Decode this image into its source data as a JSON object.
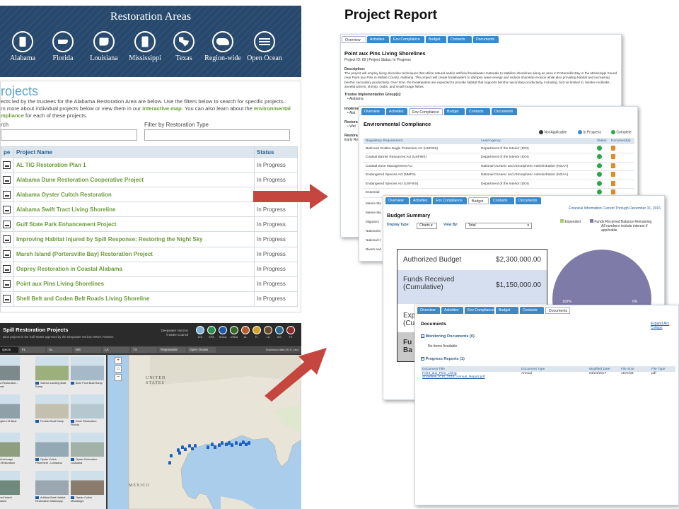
{
  "report_title": "Project Report",
  "areas": {
    "title": "Restoration Areas",
    "items": [
      {
        "label": "Alabama",
        "icon": "alabama-icon"
      },
      {
        "label": "Florida",
        "icon": "florida-icon"
      },
      {
        "label": "Louisiana",
        "icon": "louisiana-icon"
      },
      {
        "label": "Mississippi",
        "icon": "mississippi-icon"
      },
      {
        "label": "Texas",
        "icon": "texas-icon"
      },
      {
        "label": "Region-wide",
        "icon": "region-wide-icon"
      },
      {
        "label": "Open Ocean",
        "icon": "open-ocean-icon"
      }
    ]
  },
  "projects": {
    "heading": "rojects",
    "intro_1": "ects led by the trustees for the Alabama Restoration Area are below. Use the filters below to search for specific projects.",
    "intro_2": "rn more about individual projects below or view them in our ",
    "intro_link_map": "interactive map",
    "intro_3": ". You can also learn about the ",
    "intro_link_env": "environmental",
    "intro_link_env_2": "mpliance",
    "intro_4": " for each of these projects.",
    "search_label": "rch",
    "filter_label": "Filter by Restoration Type",
    "columns": [
      "pe",
      "Project Name",
      "Status"
    ],
    "rows": [
      {
        "name": "AL TIG Restoration Plan 1",
        "status": "In Progress"
      },
      {
        "name": "Alabama Dune Restoration Cooperative Project",
        "status": "In Progress"
      },
      {
        "name": "Alabama Oyster Cultch Restoration",
        "status": ""
      },
      {
        "name": "Alabama Swift Tract Living Shoreline",
        "status": "In Progress"
      },
      {
        "name": "Gulf State Park Enhancement Project",
        "status": "In Progress"
      },
      {
        "name": "Improving Habitat Injured by Spill Response: Restoring the Night Sky",
        "status": "In Progress"
      },
      {
        "name": "Marsh Island (Portersville Bay) Restoration Project",
        "status": "In Progress"
      },
      {
        "name": "Osprey Restoration in Coastal Alabama",
        "status": "In Progress"
      },
      {
        "name": "Point aux Pins Living Shorelines",
        "status": "In Progress"
      },
      {
        "name": "Shell Belt and Coden Belt Roads Living Shoreline",
        "status": "In Progress"
      }
    ]
  },
  "map_panel": {
    "title": "Spill Restoration Projects",
    "subtitle": "ation projects in the Gulf States approved by the Deepwater Horizon NRDA Trustees",
    "trustee": "Deepwater Horizon Trustee Council",
    "logos": [
      "DOI",
      "EPA",
      "NOAA",
      "USDA",
      "AL",
      "FL",
      "LA",
      "MS",
      "TX"
    ],
    "tabs": [
      "ojects",
      "FL",
      "AL",
      "MS",
      "LA",
      "TX",
      "Regionwide",
      "Open Ocean"
    ],
    "download": "Download data (XLS, csv)",
    "map_labels": {
      "us": "UNITED\nSTATES",
      "mexico": "MEXICO"
    },
    "thumbs": [
      "ma Restoration - Lightpost",
      "Salmon Landing Boat Ramp",
      "Bear Point Boat Ramp",
      "lington Hill Boat Ramp",
      "Perdido Boat Ramp",
      "Dune Restoration Florida",
      "n Anchorage Marsh Restoration",
      "Oyster Cultch Placement - Louisiana",
      "Oyster Relocation - Louisiana",
      "Shell Island Restoration",
      "Artificial Reef Habitat Restoration Mississippi",
      "Oyster Cultch Mississippi"
    ]
  },
  "win1": {
    "tabs": [
      "Overview",
      "Activities",
      "Env Compliance",
      "Budget",
      "Contacts",
      "Documents"
    ],
    "title": "Point aux Pins Living Shorelines",
    "meta": "Project ID: 69 | Project Status: In Progress",
    "desc_label": "Description:",
    "desc": "The project will employ living shoreline techniques that utilize natural and/or artificial breakwater materials to stabilize shorelines along an area in Portersville Bay in the Mississippi Sound near Point aux Pins in Mobile County, Alabama. The project will create breakwaters to dampen wave energy and reduce shoreline erosion while also providing habitat and increasing benthic secondary productivity. Over time, the breakwaters are expected to provide habitat that supports benthic secondary productivity, including, but not limited to, bivalve mollusks, annelid worms, shrimp, crabs, and small forage fishes.",
    "trustee_label": "Trustee Implementation Group(s):",
    "trustee_item": "• Alabama",
    "impl_label": "Impleme",
    "impl_item": "• Alal",
    "resto_label": "Restora",
    "resto_item": "• Wet",
    "resto2_label": "Restora",
    "resto2_item": "Early Re"
  },
  "win2": {
    "tabs": [
      "Overview",
      "Activities",
      "Env Compliance",
      "Budget",
      "Contacts",
      "Documents"
    ],
    "title": "Environmental Compliance",
    "legend": [
      "Not Applicable",
      "In Progress",
      "Complete"
    ],
    "columns": [
      "Regulatory Requirement",
      "Lead Agency",
      "Status",
      "Document(s)"
    ],
    "rows": [
      {
        "req": "Bald and Golden Eagle Protection Act (USFWS)",
        "agency": "Department of the Interior (DOI)"
      },
      {
        "req": "Coastal Barrier Resources Act (USFWS)",
        "agency": "Department of the Interior (DOI)"
      },
      {
        "req": "Coastal Zone Management Act",
        "agency": "National Oceanic and Atmospheric Administration (NOAA)"
      },
      {
        "req": "Endangered Species Act (NMFS)",
        "agency": "National Oceanic and Atmospheric Administration (NOAA)"
      },
      {
        "req": "Endangered Species Act (USFWS)",
        "agency": "Department of the Interior (DOI)"
      },
      {
        "req": "Essential",
        "agency": ""
      }
    ],
    "side_items": [
      "Marine Ma",
      "Marine Ma",
      "Migratory",
      "National E",
      "National H",
      "Rivers and"
    ]
  },
  "win3": {
    "tabs": [
      "Overview",
      "Activities",
      "Env Compliance",
      "Budget",
      "Contacts",
      "Documents"
    ],
    "info": "Financial Information Current Through December 31, 2016",
    "title": "Budget Summary",
    "display_label": "Display Type:",
    "display_value": "Charts",
    "view_label": "View By:",
    "view_value": "Total",
    "legend_expended": "Expended",
    "legend_remaining": "Funds Received Balance Remaining",
    "legend_note": "All numbers include interest if applicable",
    "rows": [
      {
        "label": "Authorized Budget",
        "value": "$2,300,000.00"
      },
      {
        "label": "Funds Received (Cumulative)",
        "value": "$1,150,000.00"
      },
      {
        "label": "Exp (Cu",
        "value": ""
      },
      {
        "label": "Fu Ba",
        "value": ""
      }
    ],
    "pie_label_left": "100%",
    "pie_label_right": "0%"
  },
  "win4": {
    "tabs": [
      "Overview",
      "Activities",
      "Env Compliance",
      "Budget",
      "Contacts",
      "Documents"
    ],
    "title": "Documents",
    "expand_link": "Expand All",
    "collapse_link": "Collaps",
    "monitoring": "Monitoring Documents (0)",
    "no_items": "No Items Available",
    "progress": "Progress Reports (1)",
    "columns": [
      "Document Title",
      "Document Type",
      "Modified Date",
      "File Size",
      "File Type"
    ],
    "doc": {
      "title": "Point_aux_Pins_Living Shoreline_ICIS_2016_Annual_Report.pdf",
      "type": "Annual",
      "date": "04/24/2017",
      "size": "1570 kB",
      "ftype": "pdf"
    }
  },
  "colors": {
    "banner": "#27496d",
    "accent_green": "#6a9a3a",
    "tab_blue": "#3a89c9",
    "arrow_red": "#c4463e"
  }
}
